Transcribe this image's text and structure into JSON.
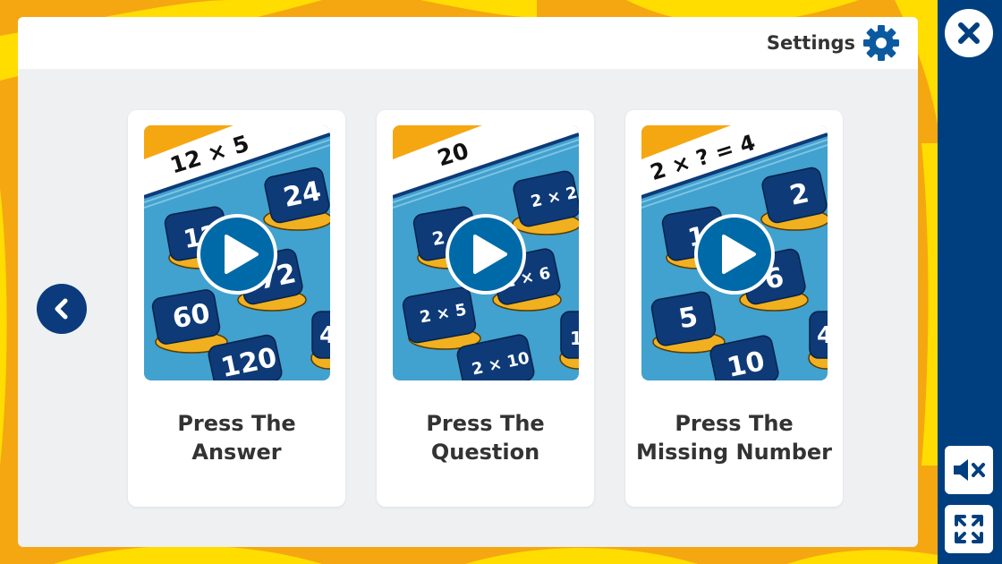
{
  "header": {
    "settings_label": "Settings"
  },
  "cards": [
    {
      "equation": "12 × 5",
      "tiles": [
        "12",
        "24",
        "72",
        "60",
        "120",
        "4"
      ],
      "title_line1": "Press The",
      "title_line2": "Answer"
    },
    {
      "equation": "20",
      "tiles": [
        "2",
        "2 × 2",
        "2 × 6",
        "2 × 5",
        "2 × 10",
        "1"
      ],
      "title_line1": "Press The",
      "title_line2": "Question"
    },
    {
      "equation": "2 × ? = 4",
      "tiles": [
        "1",
        "2",
        "6",
        "5",
        "10",
        "4"
      ],
      "title_line1": "Press The",
      "title_line2": "Missing Number"
    }
  ],
  "colors": {
    "background_orange": "#f5a712",
    "background_yellow": "#ffdd00",
    "sidebar_blue": "#003f7f",
    "panel_grey": "#eef0f2",
    "tile_navy": "#0e3a78",
    "board_blue": "#41a1cf",
    "play_blue": "#006aa8"
  },
  "icons": {
    "close": "close-icon",
    "mute": "sound-off-icon",
    "fullscreen": "expand-icon",
    "settings": "gear-icon",
    "previous": "chevron-left-icon",
    "play": "play-icon"
  }
}
